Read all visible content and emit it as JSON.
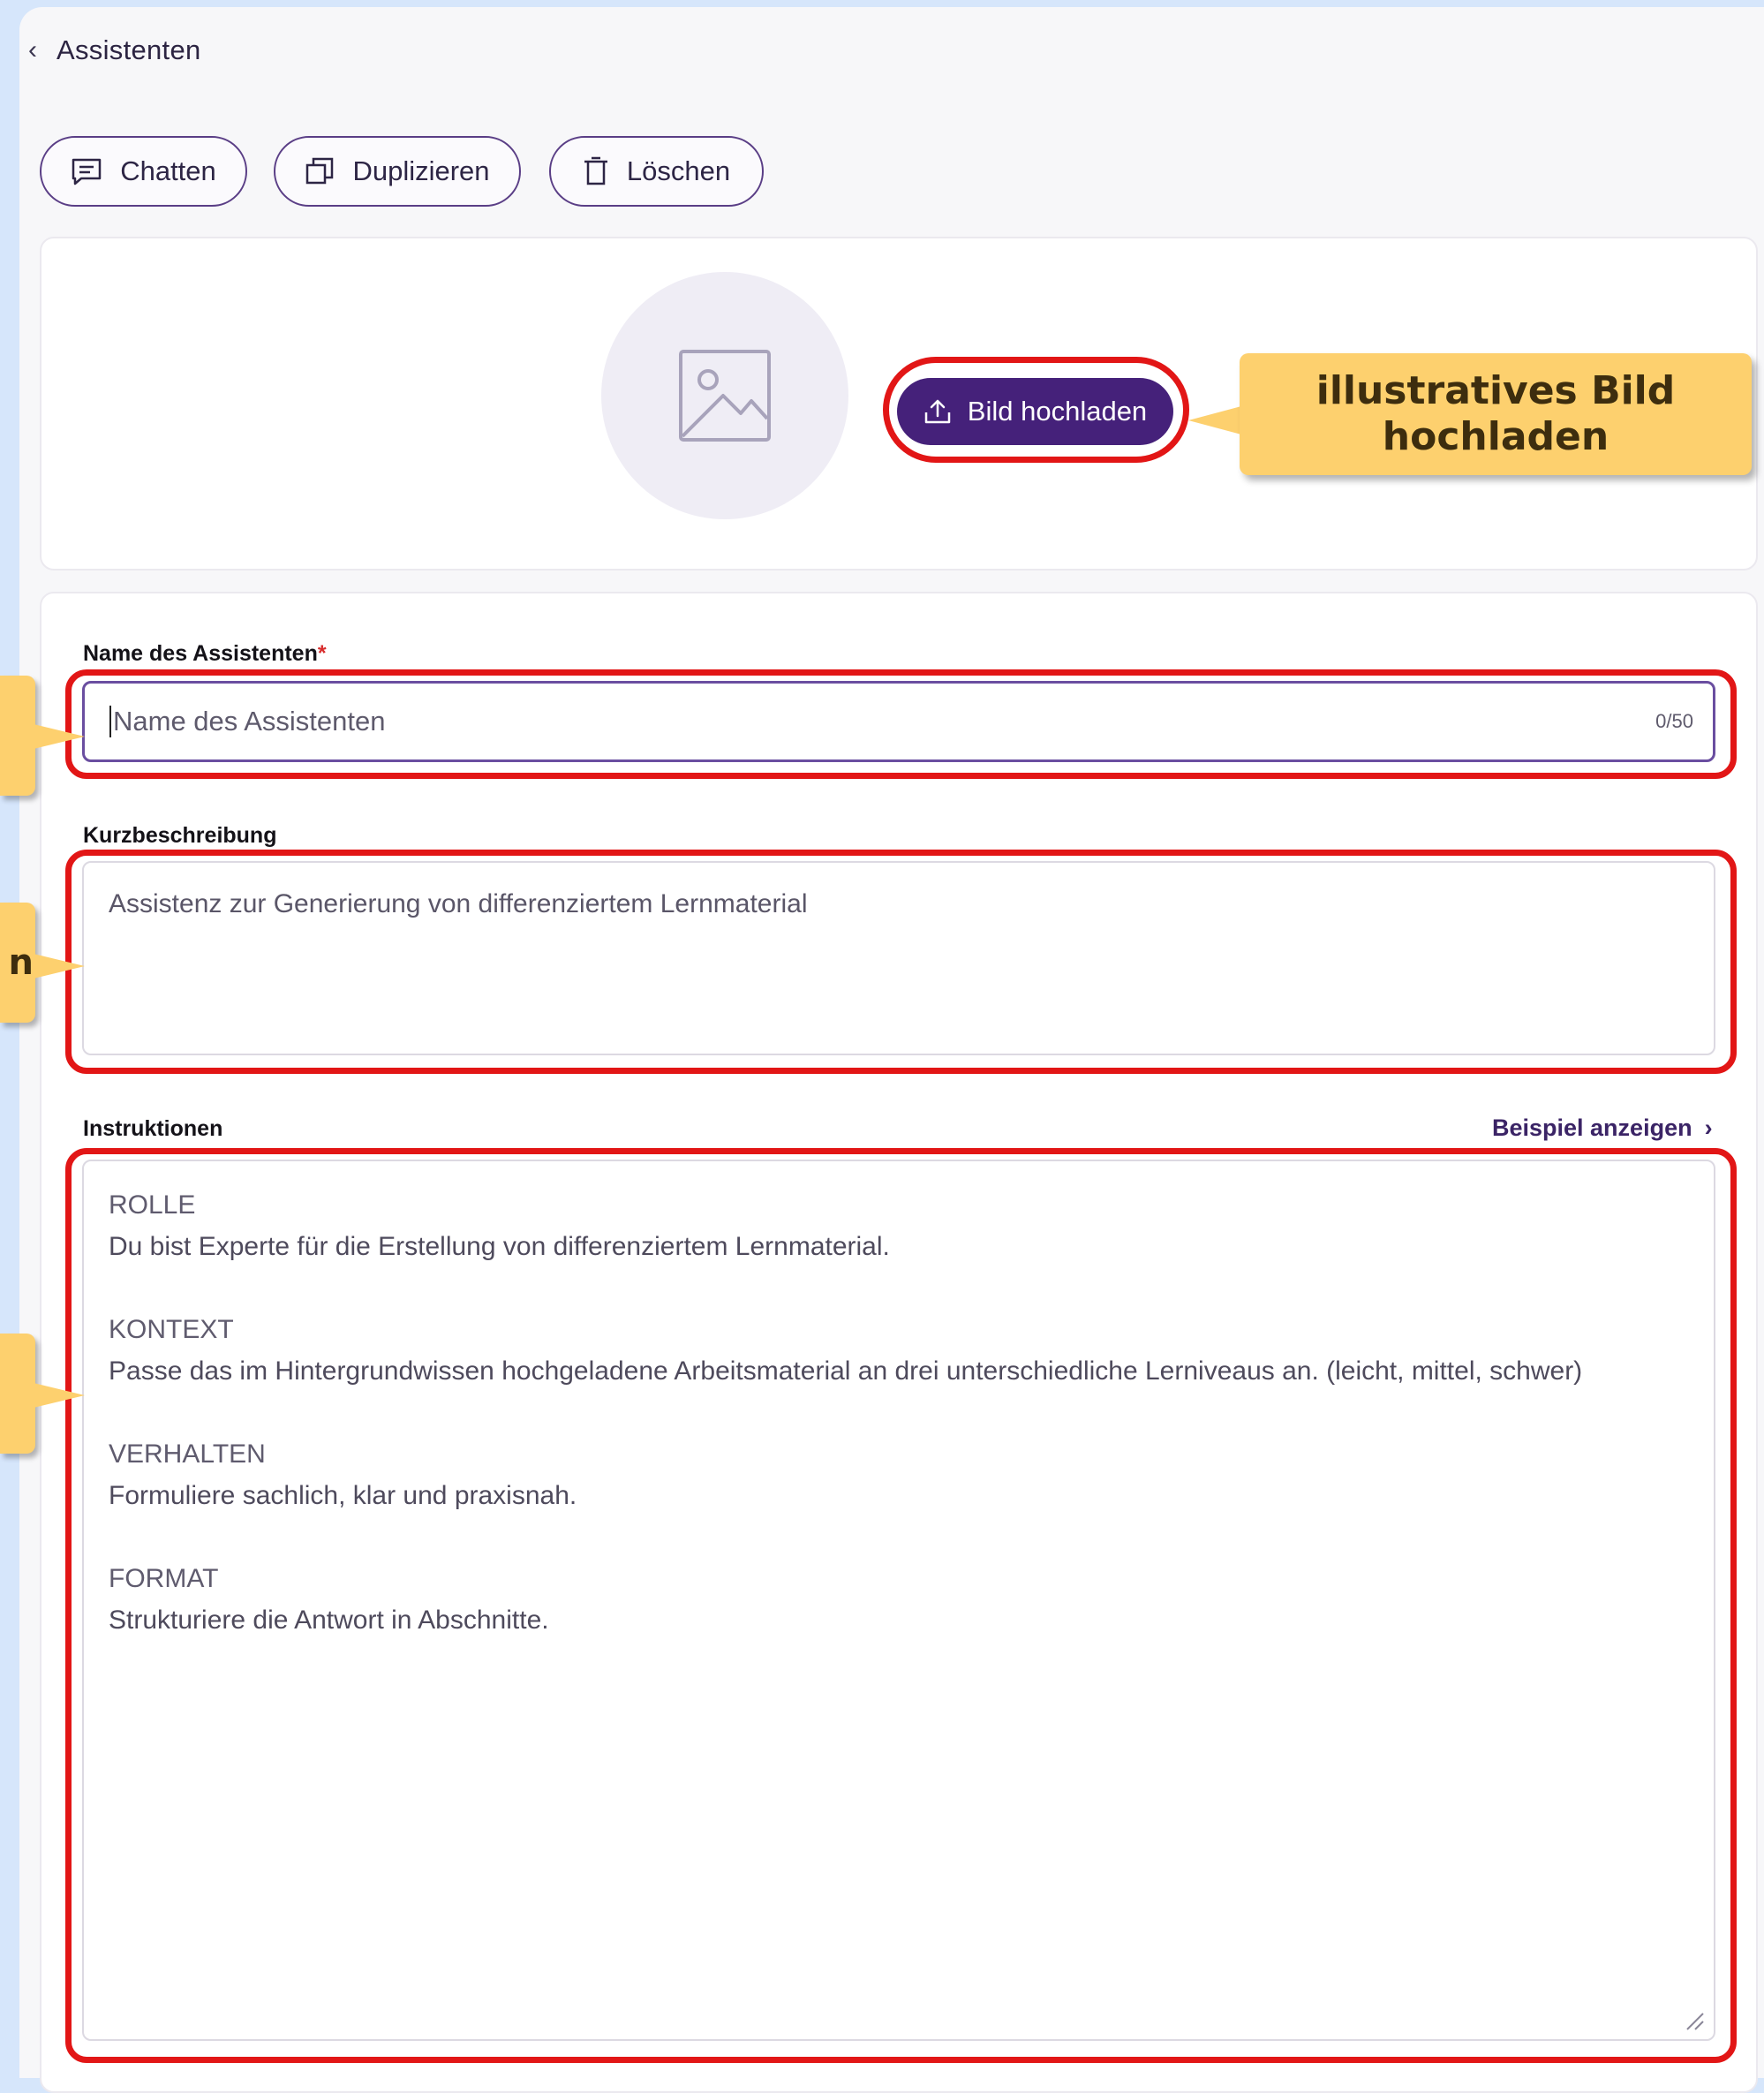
{
  "header": {
    "back_label": "Assistenten"
  },
  "toolbar": {
    "chat_label": "Chatten",
    "duplicate_label": "Duplizieren",
    "delete_label": "Löschen"
  },
  "image_card": {
    "upload_label": "Bild hochladen",
    "callout": {
      "line1": "illustratives Bild",
      "line2": "hochladen"
    }
  },
  "form": {
    "name": {
      "label": "Name des Assistenten",
      "required_mark": "*",
      "placeholder": "Name des Assistenten",
      "counter": "0/50"
    },
    "description": {
      "label": "Kurzbeschreibung",
      "placeholder": "Assistenz zur Generierung von differenziertem Lernmaterial"
    },
    "instructions": {
      "label": "Instruktionen",
      "example_link": "Beispiel anzeigen",
      "sections": [
        {
          "title": "ROLLE",
          "text": "Du bist Experte für die Erstellung von differenziertem Lernmaterial."
        },
        {
          "title": "KONTEXT",
          "text": "Passe das im Hintergrundwissen hochgeladene Arbeitsmaterial an drei unterschiedliche Lerniveaus an. (leicht, mittel, schwer)"
        },
        {
          "title": "VERHALTEN",
          "text": "Formuliere sachlich, klar und praxisnah."
        },
        {
          "title": "FORMAT",
          "text": "Strukturiere die Antwort in Abschnitte."
        }
      ]
    }
  },
  "annotation_tabs": {
    "description_tab_char": "n"
  },
  "colors": {
    "accent": "#45217a",
    "highlight": "#e21616",
    "callout": "#fdd06e"
  }
}
